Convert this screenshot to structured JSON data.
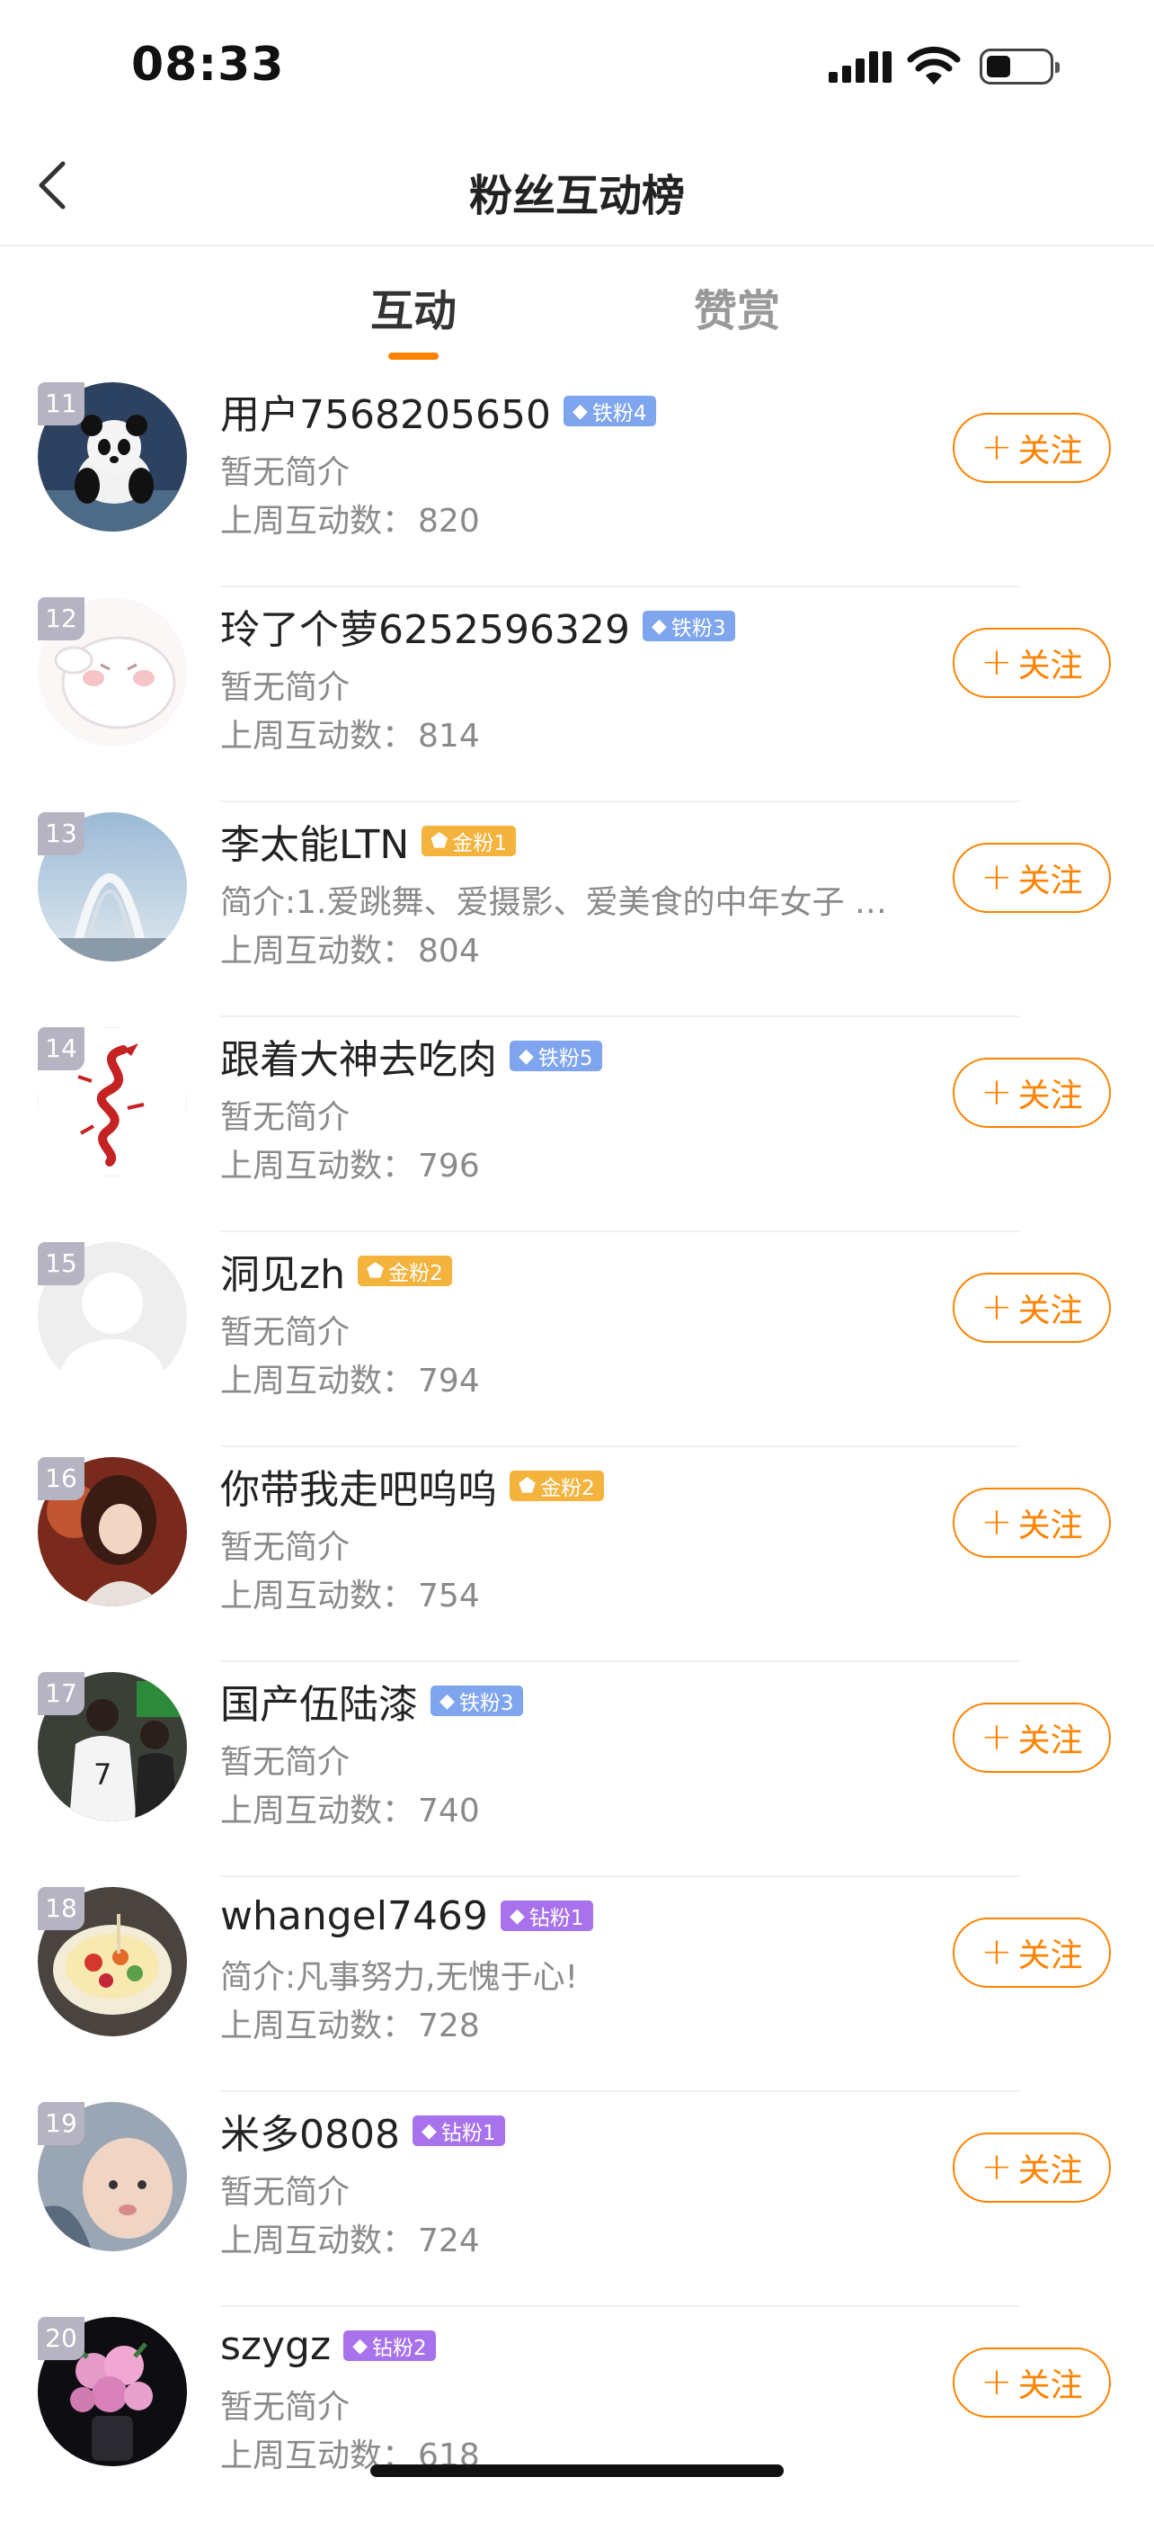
{
  "status_bar": {
    "time": "08:33"
  },
  "nav": {
    "title": "粉丝互动榜"
  },
  "tabs": [
    {
      "label": "互动",
      "active": true
    },
    {
      "label": "赞赏",
      "active": false
    }
  ],
  "colors": {
    "accent": "#ff8200",
    "iron_badge": "#7ea5ee",
    "gold_badge": "#f4b33d",
    "diamond_badge": "#a872ec",
    "rank_tag": "#b6b4c2"
  },
  "follow_plus": "+",
  "follow_label": "关注",
  "count_label": "上周互动数：",
  "fans": [
    {
      "rank": "11",
      "name": "用户7568205650",
      "badge": "铁粉4",
      "badge_type": "iron",
      "bio": "暂无简介",
      "count": "820",
      "avatar": "panda"
    },
    {
      "rank": "12",
      "name": "玲了个萝6252596329",
      "badge": "铁粉3",
      "badge_type": "iron",
      "bio": "暂无简介",
      "count": "814",
      "avatar": "cartoon"
    },
    {
      "rank": "13",
      "name": "李太能LTN",
      "badge": "金粉1",
      "badge_type": "gold",
      "bio": "简介:1.爱跳舞、爱摄影、爱美食的中年女子 2....",
      "count": "804",
      "avatar": "arch"
    },
    {
      "rank": "14",
      "name": "跟着大神去吃肉",
      "badge": "铁粉5",
      "badge_type": "iron",
      "bio": "暂无简介",
      "count": "796",
      "avatar": "dragon"
    },
    {
      "rank": "15",
      "name": "洞见zh",
      "badge": "金粉2",
      "badge_type": "gold",
      "bio": "暂无简介",
      "count": "794",
      "avatar": "default"
    },
    {
      "rank": "16",
      "name": "你带我走吧呜呜",
      "badge": "金粉2",
      "badge_type": "gold",
      "bio": "暂无简介",
      "count": "754",
      "avatar": "anime"
    },
    {
      "rank": "17",
      "name": "国产伍陆漆",
      "badge": "铁粉3",
      "badge_type": "iron",
      "bio": "暂无简介",
      "count": "740",
      "avatar": "player"
    },
    {
      "rank": "18",
      "name": "whangel7469",
      "badge": "钻粉1",
      "badge_type": "diamond",
      "bio": "简介:凡事努力,无愧于心!",
      "count": "728",
      "avatar": "cake"
    },
    {
      "rank": "19",
      "name": "米多0808",
      "badge": "钻粉1",
      "badge_type": "diamond",
      "bio": "暂无简介",
      "count": "724",
      "avatar": "baby"
    },
    {
      "rank": "20",
      "name": "szygz",
      "badge": "钻粉2",
      "badge_type": "diamond",
      "bio": "暂无简介",
      "count": "618",
      "avatar": "flowers"
    }
  ]
}
